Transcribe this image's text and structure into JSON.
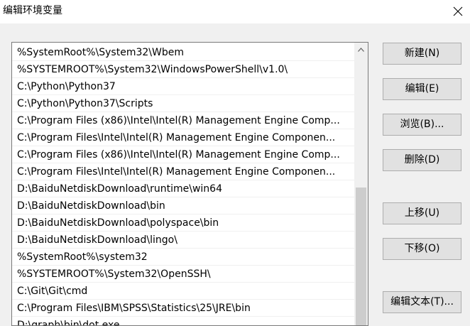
{
  "window": {
    "title": "编辑环境变量",
    "close_icon": "close-icon"
  },
  "paths": [
    "%SystemRoot%\\System32\\Wbem",
    "%SYSTEMROOT%\\System32\\WindowsPowerShell\\v1.0\\",
    "C:\\Python\\Python37",
    "C:\\Python\\Python37\\Scripts",
    "C:\\Program Files (x86)\\Intel\\Intel(R) Management Engine Comp...",
    "C:\\Program Files\\Intel\\Intel(R) Management Engine Componen...",
    "C:\\Program Files (x86)\\Intel\\Intel(R) Management Engine Comp...",
    "C:\\Program Files\\Intel\\Intel(R) Management Engine Componen...",
    "D:\\BaiduNetdiskDownload\\runtime\\win64",
    "D:\\BaiduNetdiskDownload\\bin",
    "D:\\BaiduNetdiskDownload\\polyspace\\bin",
    "D:\\BaiduNetdiskDownload\\lingo\\",
    "%SystemRoot%\\system32",
    "%SYSTEMROOT%\\System32\\OpenSSH\\",
    "C:\\Git\\Git\\cmd",
    "C:\\Program Files\\IBM\\SPSS\\Statistics\\25\\JRE\\bin",
    "D:\\graph\\bin\\dot.exe"
  ],
  "buttons": {
    "new": "新建(N)",
    "edit": "编辑(E)",
    "browse": "浏览(B)...",
    "delete": "删除(D)",
    "move_up": "上移(U)",
    "move_down": "下移(O)",
    "edit_text": "编辑文本(T)..."
  }
}
